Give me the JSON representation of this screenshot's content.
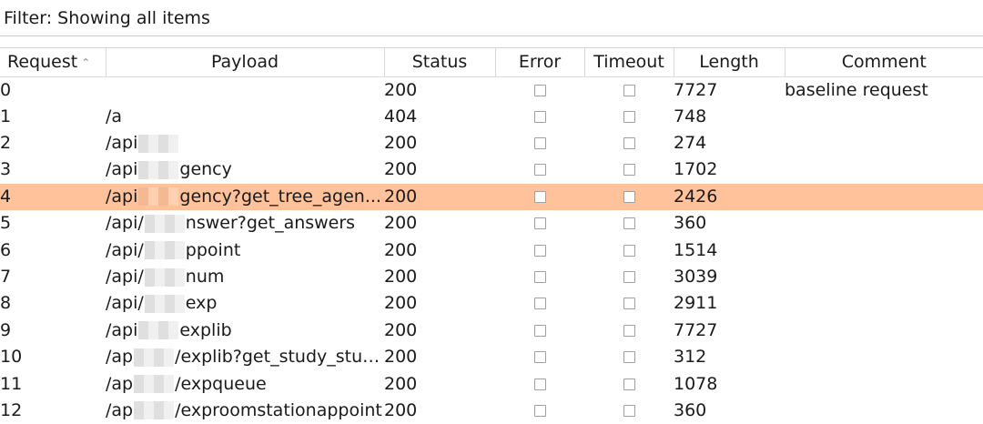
{
  "filter": {
    "text": "Filter: Showing all items"
  },
  "table": {
    "columns": [
      "Request",
      "Payload",
      "Status",
      "Error",
      "Timeout",
      "Length",
      "Comment"
    ],
    "sort_indicator": "^",
    "selected_row_index": 4,
    "rows": [
      {
        "request": "0",
        "payload_pre": "",
        "payload_post": "",
        "redacted": false,
        "status": "200",
        "error": false,
        "timeout": false,
        "length": "7727",
        "comment": "baseline request"
      },
      {
        "request": "1",
        "payload_pre": "/a",
        "payload_post": "",
        "redacted": false,
        "status": "404",
        "error": false,
        "timeout": false,
        "length": "748",
        "comment": ""
      },
      {
        "request": "2",
        "payload_pre": "/api",
        "payload_post": "",
        "redacted": true,
        "status": "200",
        "error": false,
        "timeout": false,
        "length": "274",
        "comment": ""
      },
      {
        "request": "3",
        "payload_pre": "/api",
        "payload_post": "gency",
        "redacted": true,
        "status": "200",
        "error": false,
        "timeout": false,
        "length": "1702",
        "comment": ""
      },
      {
        "request": "4",
        "payload_pre": "/api",
        "payload_post": "gency?get_tree_agen...",
        "redacted": true,
        "status": "200",
        "error": false,
        "timeout": false,
        "length": "2426",
        "comment": ""
      },
      {
        "request": "5",
        "payload_pre": "/api/",
        "payload_post": "nswer?get_answers",
        "redacted": true,
        "status": "200",
        "error": false,
        "timeout": false,
        "length": "360",
        "comment": ""
      },
      {
        "request": "6",
        "payload_pre": "/api/",
        "payload_post": "ppoint",
        "redacted": true,
        "status": "200",
        "error": false,
        "timeout": false,
        "length": "1514",
        "comment": ""
      },
      {
        "request": "7",
        "payload_pre": "/api/",
        "payload_post": "num",
        "redacted": true,
        "status": "200",
        "error": false,
        "timeout": false,
        "length": "3039",
        "comment": ""
      },
      {
        "request": "8",
        "payload_pre": "/api/",
        "payload_post": "exp",
        "redacted": true,
        "status": "200",
        "error": false,
        "timeout": false,
        "length": "2911",
        "comment": ""
      },
      {
        "request": "9",
        "payload_pre": "/api",
        "payload_post": "explib",
        "redacted": true,
        "status": "200",
        "error": false,
        "timeout": false,
        "length": "7727",
        "comment": ""
      },
      {
        "request": "10",
        "payload_pre": "/ap",
        "payload_post": "/explib?get_study_stud...",
        "redacted": true,
        "status": "200",
        "error": false,
        "timeout": false,
        "length": "312",
        "comment": ""
      },
      {
        "request": "11",
        "payload_pre": "/ap",
        "payload_post": "/expqueue",
        "redacted": true,
        "status": "200",
        "error": false,
        "timeout": false,
        "length": "1078",
        "comment": ""
      },
      {
        "request": "12",
        "payload_pre": "/ap",
        "payload_post": "/exproomstationappoint",
        "redacted": true,
        "status": "200",
        "error": false,
        "timeout": false,
        "length": "360",
        "comment": ""
      }
    ]
  },
  "colors": {
    "selected_row": "#ffc29a",
    "header_border": "#d8d8d8"
  }
}
